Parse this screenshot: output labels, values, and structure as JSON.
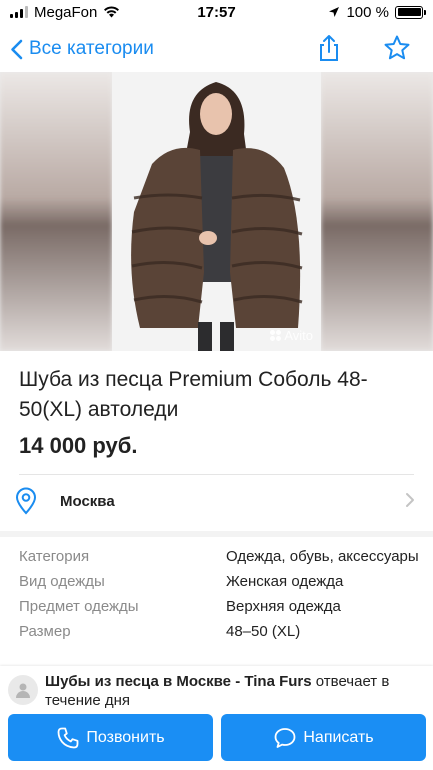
{
  "status_bar": {
    "carrier": "MegaFon",
    "time": "17:57",
    "battery": "100 %",
    "battery_level": 1.0
  },
  "nav": {
    "back_label": "Все категории",
    "icons": [
      "chevron-left-icon",
      "share-icon",
      "star-icon"
    ]
  },
  "gallery": {
    "watermark": "Avito"
  },
  "listing": {
    "title": "Шуба из песца Premium Соболь 48-50(XL) автоледи",
    "price": "14 000 руб."
  },
  "location": {
    "city": "Москва"
  },
  "params": [
    {
      "key": "Категория",
      "value": "Одежда, обувь, аксессуары"
    },
    {
      "key": "Вид одежды",
      "value": "Женская одежда"
    },
    {
      "key": "Предмет одежды",
      "value": "Верхняя одежда"
    },
    {
      "key": "Размер",
      "value": "48–50 (XL)"
    }
  ],
  "seller": {
    "name": "Шубы из песца в Москве - Tina Furs",
    "response": " отвечает в течение дня"
  },
  "actions": {
    "call_label": "Позвонить",
    "write_label": "Написать"
  },
  "colors": {
    "accent": "#1a8ef4",
    "link": "#1a8cf0"
  }
}
